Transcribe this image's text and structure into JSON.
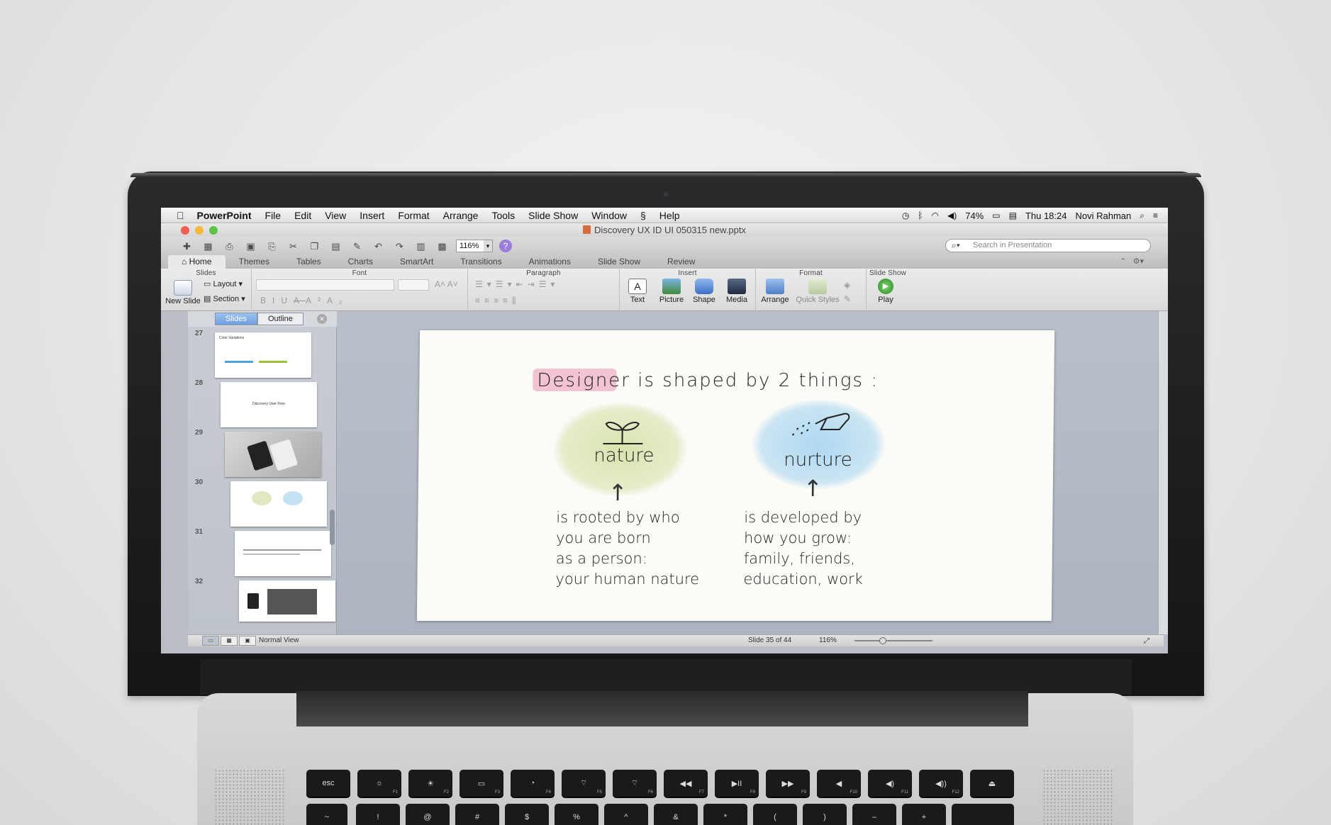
{
  "menubar": {
    "app": "PowerPoint",
    "items": [
      "File",
      "Edit",
      "View",
      "Insert",
      "Format",
      "Arrange",
      "Tools",
      "Slide Show",
      "Window",
      "Help"
    ],
    "battery": "74%",
    "clock": "Thu 18:24",
    "user": "Novi Rahman"
  },
  "window": {
    "title": "Discovery UX ID UI 050315 new.pptx"
  },
  "toolbar": {
    "zoom": "116%",
    "search_placeholder": "Search in Presentation"
  },
  "ribbon_tabs": [
    "Home",
    "Themes",
    "Tables",
    "Charts",
    "SmartArt",
    "Transitions",
    "Animations",
    "Slide Show",
    "Review"
  ],
  "ribbon": {
    "groups": {
      "slides": "Slides",
      "font": "Font",
      "paragraph": "Paragraph",
      "insert": "Insert",
      "format": "Format",
      "slideshow": "Slide Show"
    },
    "new_slide": "New Slide",
    "layout": "Layout",
    "section": "Section",
    "text": "Text",
    "picture": "Picture",
    "shape": "Shape",
    "media": "Media",
    "arrange": "Arrange",
    "quick_styles": "Quick Styles",
    "play": "Play"
  },
  "left_pane": {
    "tab_slides": "Slides",
    "tab_outline": "Outline",
    "thumbnails": [
      {
        "num": "27",
        "title": "Color Variations",
        "center": ""
      },
      {
        "num": "28",
        "title": "",
        "center": "Discovery User Flow"
      },
      {
        "num": "29",
        "title": "",
        "center": ""
      },
      {
        "num": "30",
        "title": "",
        "center": ""
      },
      {
        "num": "31",
        "title": "",
        "center": ""
      },
      {
        "num": "32",
        "title": "",
        "center": ""
      }
    ]
  },
  "slide": {
    "headline_word": "Designer",
    "headline_rest": "is shaped  by 2 things :",
    "left_label": "nature",
    "right_label": "nurture",
    "left_text": "is rooted by who\nyou are born\nas a person:\nyour human nature",
    "right_text": "is developed by\nhow you grow:\nfamily, friends,\neducation, work"
  },
  "statusbar": {
    "view": "Normal View",
    "position": "Slide 35 of 44",
    "zoom": "116%"
  },
  "keyboard": {
    "row1": [
      {
        "label": "esc",
        "fn": ""
      },
      {
        "label": "☼",
        "fn": "F1"
      },
      {
        "label": "☀",
        "fn": "F2"
      },
      {
        "label": "▭",
        "fn": "F3"
      },
      {
        "label": "◔",
        "fn": "F4"
      },
      {
        "label": "⌔",
        "fn": "F5"
      },
      {
        "label": "⌔",
        "fn": "F6"
      },
      {
        "label": "◀◀",
        "fn": "F7"
      },
      {
        "label": "▶II",
        "fn": "F8"
      },
      {
        "label": "▶▶",
        "fn": "F9"
      },
      {
        "label": "◀",
        "fn": "F10"
      },
      {
        "label": "◀)",
        "fn": "F11"
      },
      {
        "label": "◀))",
        "fn": "F12"
      },
      {
        "label": "⏏",
        "fn": ""
      }
    ],
    "row2": [
      "~",
      "!",
      "@",
      "#",
      "$",
      "%",
      "^",
      "&",
      "*",
      "(",
      ")",
      "–",
      "+"
    ]
  }
}
